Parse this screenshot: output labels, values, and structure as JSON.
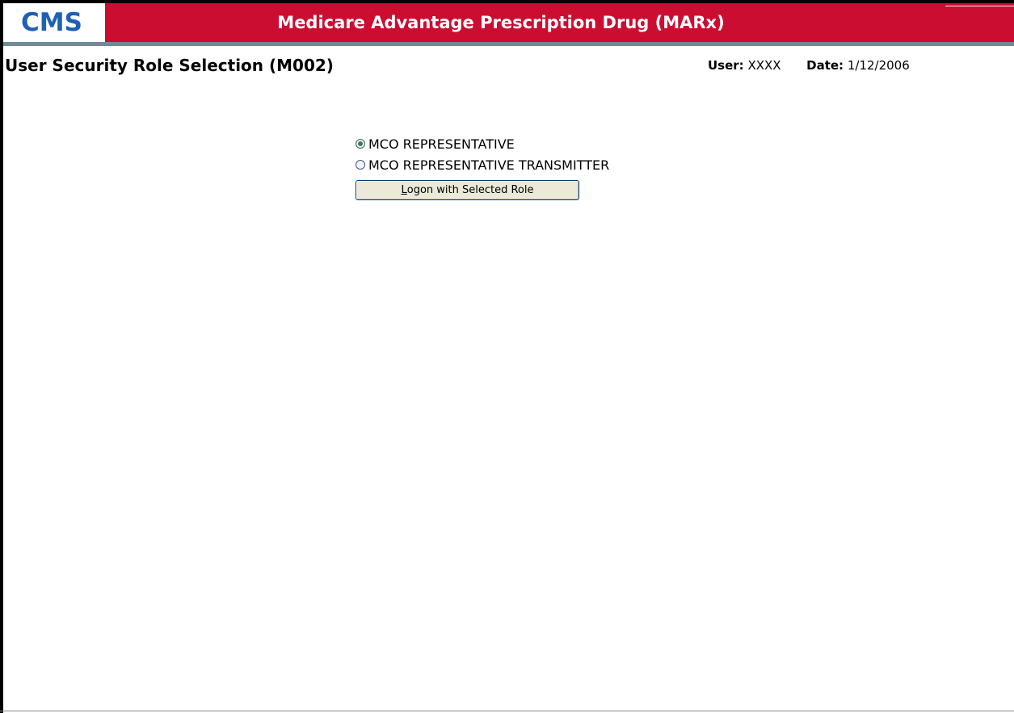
{
  "header": {
    "logo": "CMS",
    "app_title": "Medicare Advantage Prescription Drug (MARx)"
  },
  "page": {
    "title": "User Security Role Selection (M002)",
    "user_label": "User:",
    "user_value": "XXXX",
    "date_label": "Date:",
    "date_value": "1/12/2006"
  },
  "roles": {
    "options": [
      {
        "label": "MCO REPRESENTATIVE",
        "checked": true
      },
      {
        "label": "MCO REPRESENTATIVE TRANSMITTER",
        "checked": false
      }
    ],
    "selected": "MCO REPRESENTATIVE"
  },
  "logon_button": {
    "mnemonic": "L",
    "label_rest": "ogon with Selected Role"
  },
  "colors": {
    "brand_red": "#cc0d32",
    "logo_blue": "#1f5fb5",
    "divider": "#6f8b97"
  }
}
